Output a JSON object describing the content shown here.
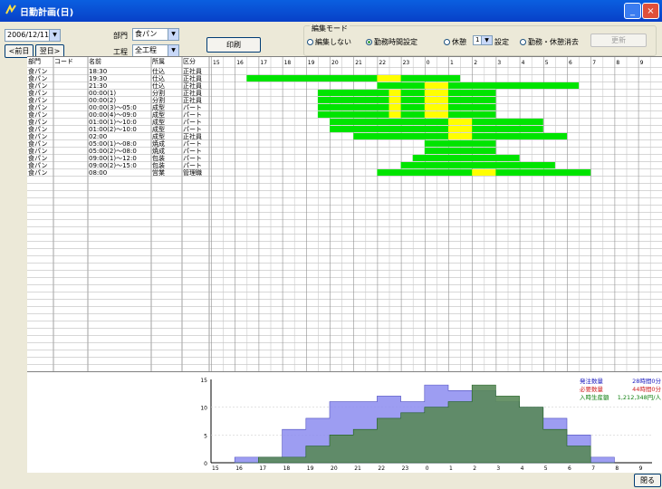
{
  "window": {
    "title": "日勤計画(日)"
  },
  "toolbar": {
    "date": "2006/12/11",
    "prev_day": "<前日",
    "next_day": "翌日>",
    "dept_label": "部門",
    "dept_value": "食パン",
    "process_label": "工程",
    "process_value": "全工程",
    "print_label": "印刷"
  },
  "edit_mode": {
    "label": "編集モード",
    "options": [
      {
        "label": "編集しない",
        "selected": false
      },
      {
        "label": "勤務時間設定",
        "selected": true
      },
      {
        "label": "休憩",
        "selected": false
      },
      {
        "label": "設定",
        "selected": false
      },
      {
        "label": "勤務・休憩消去",
        "selected": false
      }
    ],
    "break_count": "1",
    "apply_label": "更新"
  },
  "table": {
    "headers": [
      "部門",
      "コード",
      "名前",
      "所属",
      "区分"
    ],
    "hours": [
      "15",
      "16",
      "17",
      "18",
      "19",
      "20",
      "21",
      "22",
      "23",
      "0",
      "1",
      "2",
      "3",
      "4",
      "5",
      "6",
      "7",
      "8",
      "9"
    ],
    "rows": [
      {
        "dept": "食パン",
        "code": "",
        "name": "18:30",
        "team": "仕込",
        "cat": "正社員",
        "work": null,
        "breaks": []
      },
      {
        "dept": "食パン",
        "code": "",
        "name": "19:30",
        "team": "仕込",
        "cat": "正社員",
        "work": [
          16.5,
          25.5
        ],
        "breaks": [
          [
            22.0,
            23.0
          ]
        ]
      },
      {
        "dept": "食パン",
        "code": "",
        "name": "21:30",
        "team": "仕込",
        "cat": "正社員",
        "work": [
          22.0,
          30.5
        ],
        "breaks": [
          [
            24.0,
            25.0
          ]
        ]
      },
      {
        "dept": "食パン",
        "code": "",
        "name": "00:00(1)",
        "team": "分割",
        "cat": "正社員",
        "work": [
          19.5,
          27.0
        ],
        "breaks": [
          [
            22.5,
            23.0
          ],
          [
            24.0,
            25.0
          ]
        ]
      },
      {
        "dept": "食パン",
        "code": "",
        "name": "00:00(2)",
        "team": "分割",
        "cat": "正社員",
        "work": [
          19.5,
          27.0
        ],
        "breaks": [
          [
            22.5,
            23.0
          ],
          [
            24.0,
            25.0
          ]
        ]
      },
      {
        "dept": "食パン",
        "code": "",
        "name": "00:00(3)～05:0",
        "team": "成型",
        "cat": "パート",
        "work": [
          19.5,
          27.0
        ],
        "breaks": [
          [
            22.5,
            23.0
          ],
          [
            24.0,
            25.0
          ]
        ]
      },
      {
        "dept": "食パン",
        "code": "",
        "name": "00:00(4)～09:0",
        "team": "成型",
        "cat": "パート",
        "work": [
          19.5,
          27.0
        ],
        "breaks": [
          [
            22.5,
            23.0
          ],
          [
            24.0,
            25.0
          ]
        ]
      },
      {
        "dept": "食パン",
        "code": "",
        "name": "01:00(1)～10:0",
        "team": "成型",
        "cat": "パート",
        "work": [
          20.0,
          29.0
        ],
        "breaks": [
          [
            25.0,
            26.0
          ]
        ]
      },
      {
        "dept": "食パン",
        "code": "",
        "name": "01:00(2)～10:0",
        "team": "成型",
        "cat": "パート",
        "work": [
          20.0,
          29.0
        ],
        "breaks": [
          [
            25.0,
            26.0
          ]
        ]
      },
      {
        "dept": "食パン",
        "code": "",
        "name": "02:00",
        "team": "成型",
        "cat": "正社員",
        "work": [
          21.0,
          30.0
        ],
        "breaks": [
          [
            25.0,
            26.0
          ]
        ]
      },
      {
        "dept": "食パン",
        "code": "",
        "name": "05:00(1)～08:0",
        "team": "焼成",
        "cat": "パート",
        "work": [
          24.0,
          27.0
        ],
        "breaks": []
      },
      {
        "dept": "食パン",
        "code": "",
        "name": "05:00(2)～08:0",
        "team": "焼成",
        "cat": "パート",
        "work": [
          24.0,
          27.0
        ],
        "breaks": []
      },
      {
        "dept": "食パン",
        "code": "",
        "name": "09:00(1)～12:0",
        "team": "包装",
        "cat": "パート",
        "work": [
          23.5,
          28.0
        ],
        "breaks": []
      },
      {
        "dept": "食パン",
        "code": "",
        "name": "09:00(2)～15:0",
        "team": "包装",
        "cat": "パート",
        "work": [
          23.0,
          29.5
        ],
        "breaks": []
      },
      {
        "dept": "食パン",
        "code": "",
        "name": "08:00",
        "team": "営業",
        "cat": "管理職",
        "work": [
          22.0,
          31.0
        ],
        "breaks": [
          [
            26.0,
            27.0
          ]
        ]
      }
    ]
  },
  "chart_data": {
    "type": "area",
    "x_ticks": [
      "15",
      "16",
      "17",
      "18",
      "19",
      "20",
      "21",
      "22",
      "23",
      "0",
      "1",
      "2",
      "3",
      "4",
      "5",
      "6",
      "7",
      "8",
      "9"
    ],
    "ylim": [
      0,
      15
    ],
    "y_ticks": [
      "15",
      "10",
      "5",
      "0"
    ],
    "legend": [
      {
        "label": "発注数量",
        "value": "28時間0分",
        "color": "#2020c0"
      },
      {
        "label": "必要数量",
        "value": "44時間0分",
        "color": "#d02020"
      },
      {
        "label": "入時生産額",
        "value": "1,212,348円/人",
        "color": "#108010"
      }
    ],
    "series": [
      {
        "name": "発注数量",
        "color": "#8c8cf0",
        "x": [
          16,
          17,
          18,
          19,
          20,
          21,
          22,
          23,
          24,
          25,
          26,
          27,
          28,
          29,
          30,
          31
        ],
        "values": [
          1,
          1,
          6,
          8,
          11,
          11,
          12,
          11,
          14,
          13,
          13,
          11,
          10,
          8,
          5,
          1
        ]
      },
      {
        "name": "必要数量",
        "color": "#5a8a5a",
        "x": [
          16,
          17,
          18,
          19,
          20,
          21,
          22,
          23,
          24,
          25,
          26,
          27,
          28,
          29,
          30,
          31
        ],
        "values": [
          0,
          1,
          1,
          3,
          5,
          6,
          8,
          9,
          10,
          11,
          14,
          12,
          10,
          6,
          3,
          0
        ]
      }
    ]
  },
  "status": {
    "close_label": "閉る"
  },
  "colors": {
    "work": "#00e400",
    "break": "#ffff00",
    "grid_line": "#b0b0b0",
    "title_bar": "#0a5fe0"
  }
}
